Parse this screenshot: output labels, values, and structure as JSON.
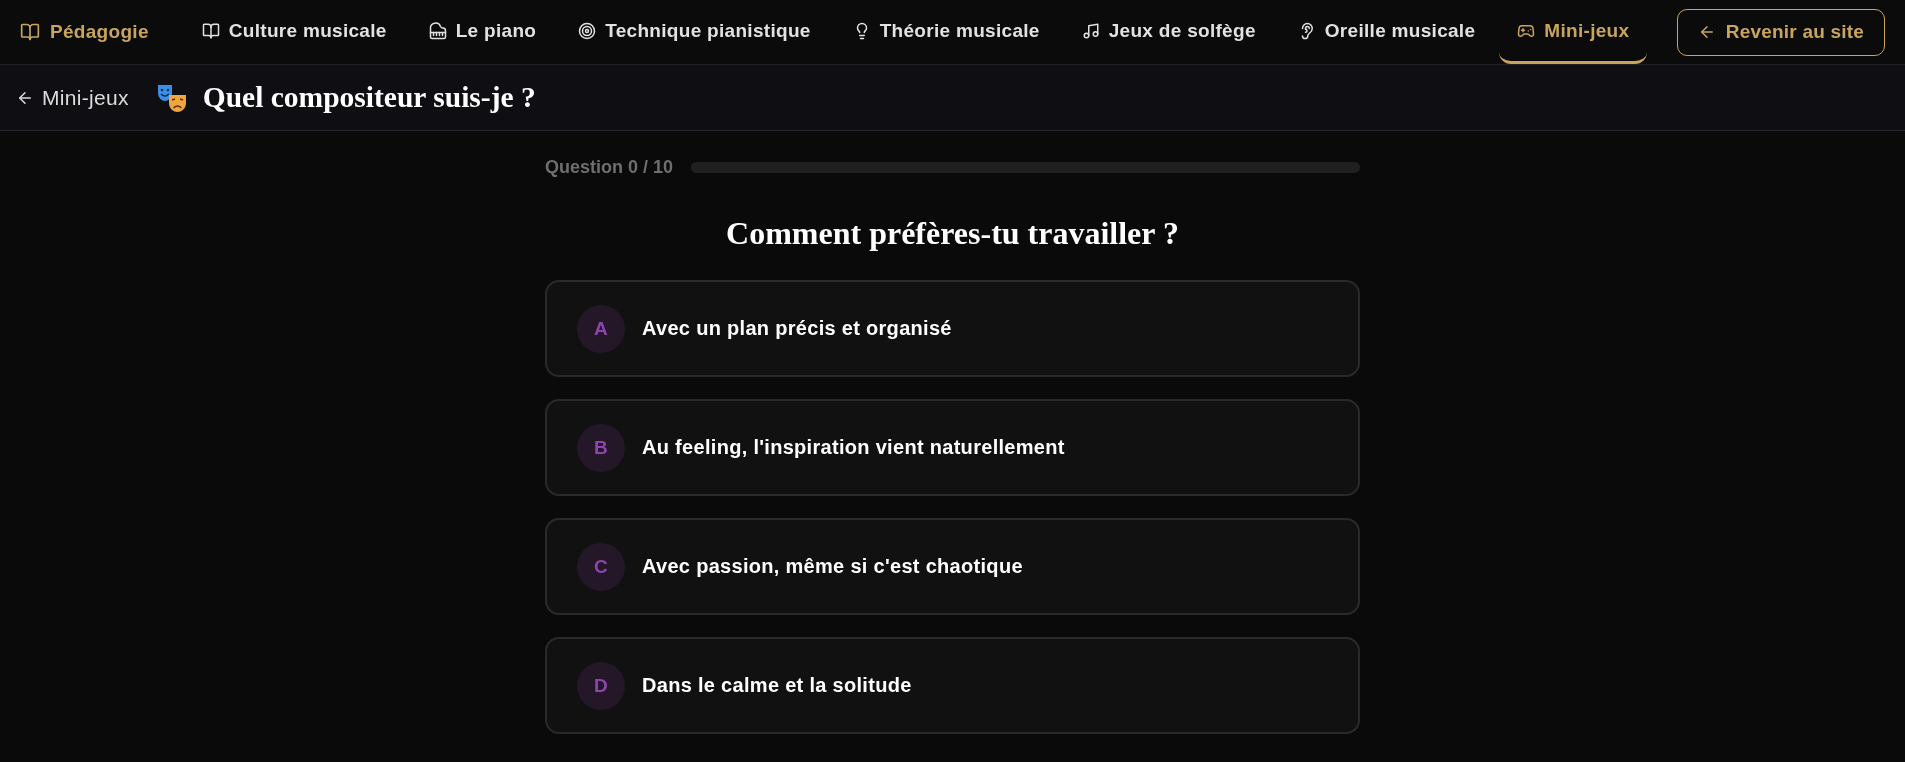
{
  "nav": {
    "brand": "Pédagogie",
    "items": [
      {
        "label": "Culture musicale",
        "selected": false
      },
      {
        "label": "Le piano",
        "selected": false
      },
      {
        "label": "Technique pianistique",
        "selected": false
      },
      {
        "label": "Théorie musicale",
        "selected": false
      },
      {
        "label": "Jeux de solfège",
        "selected": false
      },
      {
        "label": "Oreille musicale",
        "selected": false
      },
      {
        "label": "Mini-jeux",
        "selected": true
      }
    ],
    "site_button": "Revenir au site"
  },
  "header": {
    "back_link": "Mini-jeux",
    "title": "Quel compositeur suis-je ?"
  },
  "quiz": {
    "progress_label": "Question 0 / 10",
    "question": "Comment préfères-tu travailler ?",
    "options": [
      {
        "letter": "A",
        "text": "Avec un plan précis et organisé",
        "selected": false
      },
      {
        "letter": "B",
        "text": "Au feeling, l'inspiration vient naturellement",
        "selected": false
      },
      {
        "letter": "C",
        "text": "Avec passion, même si c'est chaotique",
        "selected": false
      },
      {
        "letter": "D",
        "text": "Dans le calme et la solitude",
        "selected": false
      }
    ]
  }
}
